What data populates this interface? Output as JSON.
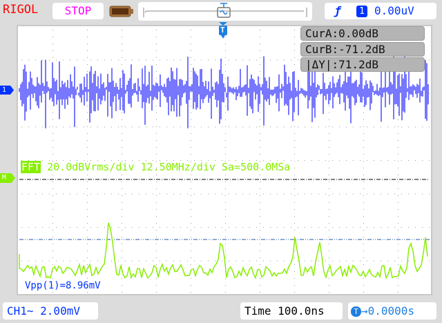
{
  "header": {
    "brand": "RIGOL",
    "run_state": "STOP",
    "trigger": {
      "edge_icon": "rising-edge-icon",
      "source": "1",
      "level": "0.00uV"
    }
  },
  "cursors": {
    "cur_a": "CurA:0.00dB",
    "cur_b": "CurB:-71.2dB",
    "delta_y": "|ΔY|:71.2dB"
  },
  "markers": {
    "ch1": "1",
    "math": "M",
    "trigger": "T"
  },
  "fft": {
    "tag": "FFT",
    "info": "20.0dBVrms/div 12.50MHz/div Sa=500.0MSa"
  },
  "measurement": {
    "vpp": "Vpp(1)=8.96mV"
  },
  "footer": {
    "channel": "CH1∼ 2.00mV",
    "timebase": "Time 100.0ns",
    "trigger_offset": "0.0000s",
    "trigger_offset_icon": "T"
  },
  "colors": {
    "ch1": "#7777ff",
    "fft": "#88ee00",
    "brand": "#ff0000",
    "stop": "#ff00ff"
  }
}
